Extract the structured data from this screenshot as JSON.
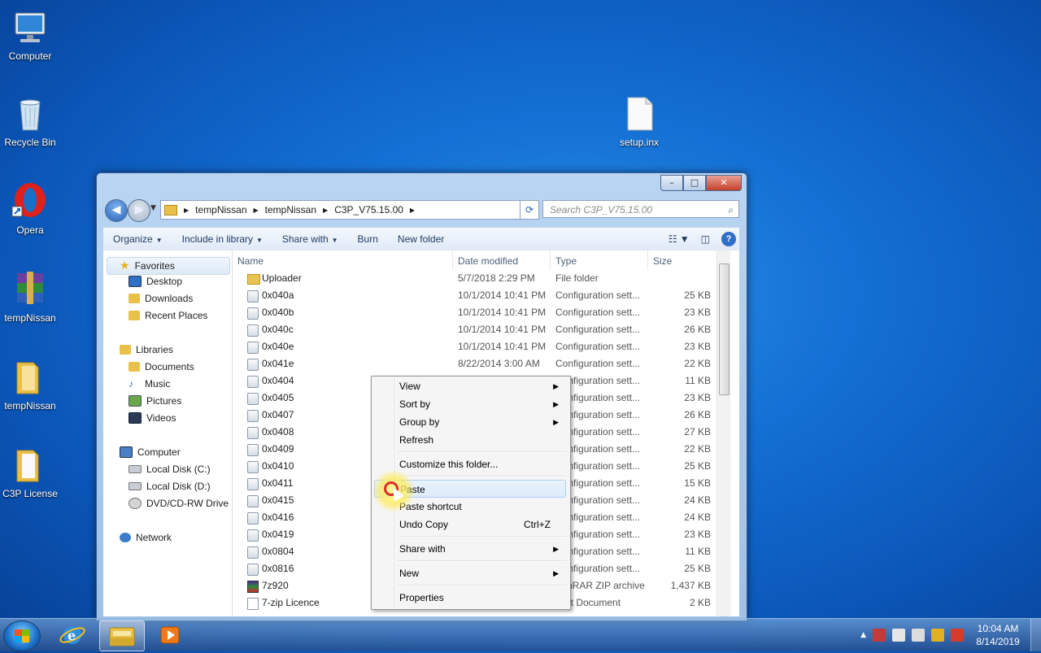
{
  "desktop": {
    "icons": [
      {
        "label": "Computer"
      },
      {
        "label": "Recycle Bin"
      },
      {
        "label": "Opera"
      },
      {
        "label": "tempNissan"
      },
      {
        "label": "tempNissan"
      },
      {
        "label": "C3P License"
      },
      {
        "label": "setup.inx"
      }
    ]
  },
  "window": {
    "controls": {
      "minimize": "–",
      "maximize": "□",
      "close": "✕"
    },
    "address": {
      "crumbs": [
        "tempNissan",
        "tempNissan",
        "C3P_V75.15.00"
      ],
      "separator": "▶"
    },
    "search": {
      "placeholder": "Search C3P_V75.15.00"
    },
    "toolbar": {
      "organize": "Organize",
      "include_in_library": "Include in library",
      "share_with": "Share with",
      "burn": "Burn",
      "new_folder": "New folder"
    },
    "nav": {
      "favorites": "Favorites",
      "desktop": "Desktop",
      "downloads": "Downloads",
      "recent_places": "Recent Places",
      "libraries": "Libraries",
      "documents": "Documents",
      "music": "Music",
      "pictures": "Pictures",
      "videos": "Videos",
      "computer": "Computer",
      "local_c": "Local Disk (C:)",
      "local_d": "Local Disk (D:)",
      "dvd": "DVD/CD-RW Drive (I",
      "network": "Network"
    },
    "columns": {
      "name": "Name",
      "date": "Date modified",
      "type": "Type",
      "size": "Size"
    },
    "files": [
      {
        "name": "Uploader",
        "date": "5/7/2018 2:29 PM",
        "type": "File folder",
        "size": "",
        "kind": "folder"
      },
      {
        "name": "0x040a",
        "date": "10/1/2014 10:41 PM",
        "type": "Configuration sett...",
        "size": "25 KB",
        "kind": "cfg"
      },
      {
        "name": "0x040b",
        "date": "10/1/2014 10:41 PM",
        "type": "Configuration sett...",
        "size": "23 KB",
        "kind": "cfg"
      },
      {
        "name": "0x040c",
        "date": "10/1/2014 10:41 PM",
        "type": "Configuration sett...",
        "size": "26 KB",
        "kind": "cfg"
      },
      {
        "name": "0x040e",
        "date": "10/1/2014 10:41 PM",
        "type": "Configuration sett...",
        "size": "23 KB",
        "kind": "cfg"
      },
      {
        "name": "0x041e",
        "date": "8/22/2014 3:00 AM",
        "type": "Configuration sett...",
        "size": "22 KB",
        "kind": "cfg"
      },
      {
        "name": "0x0404",
        "date": "",
        "type": "Configuration sett...",
        "size": "11 KB",
        "kind": "cfg"
      },
      {
        "name": "0x0405",
        "date": "",
        "type": "Configuration sett...",
        "size": "23 KB",
        "kind": "cfg"
      },
      {
        "name": "0x0407",
        "date": "",
        "type": "Configuration sett...",
        "size": "26 KB",
        "kind": "cfg"
      },
      {
        "name": "0x0408",
        "date": "",
        "type": "Configuration sett...",
        "size": "27 KB",
        "kind": "cfg"
      },
      {
        "name": "0x0409",
        "date": "",
        "type": "Configuration sett...",
        "size": "22 KB",
        "kind": "cfg"
      },
      {
        "name": "0x0410",
        "date": "",
        "type": "Configuration sett...",
        "size": "25 KB",
        "kind": "cfg"
      },
      {
        "name": "0x0411",
        "date": "",
        "type": "Configuration sett...",
        "size": "15 KB",
        "kind": "cfg"
      },
      {
        "name": "0x0415",
        "date": "",
        "type": "Configuration sett...",
        "size": "24 KB",
        "kind": "cfg"
      },
      {
        "name": "0x0416",
        "date": "",
        "type": "Configuration sett...",
        "size": "24 KB",
        "kind": "cfg"
      },
      {
        "name": "0x0419",
        "date": "",
        "type": "Configuration sett...",
        "size": "23 KB",
        "kind": "cfg"
      },
      {
        "name": "0x0804",
        "date": "",
        "type": "Configuration sett...",
        "size": "11 KB",
        "kind": "cfg"
      },
      {
        "name": "0x0816",
        "date": "",
        "type": "Configuration sett...",
        "size": "25 KB",
        "kind": "cfg"
      },
      {
        "name": "7z920",
        "date": "",
        "type": "WinRAR ZIP archive",
        "size": "1,437 KB",
        "kind": "zip"
      },
      {
        "name": "7-zip Licence",
        "date": "",
        "type": "Text Document",
        "size": "2 KB",
        "kind": "txt"
      }
    ]
  },
  "context_menu": {
    "view": "View",
    "sort_by": "Sort by",
    "group_by": "Group by",
    "refresh": "Refresh",
    "customize": "Customize this folder...",
    "paste": "Paste",
    "paste_shortcut": "Paste shortcut",
    "undo_copy": "Undo Copy",
    "undo_copy_shortcut": "Ctrl+Z",
    "share_with": "Share with",
    "new": "New",
    "properties": "Properties"
  },
  "taskbar": {
    "time": "10:04 AM",
    "date": "8/14/2019"
  }
}
